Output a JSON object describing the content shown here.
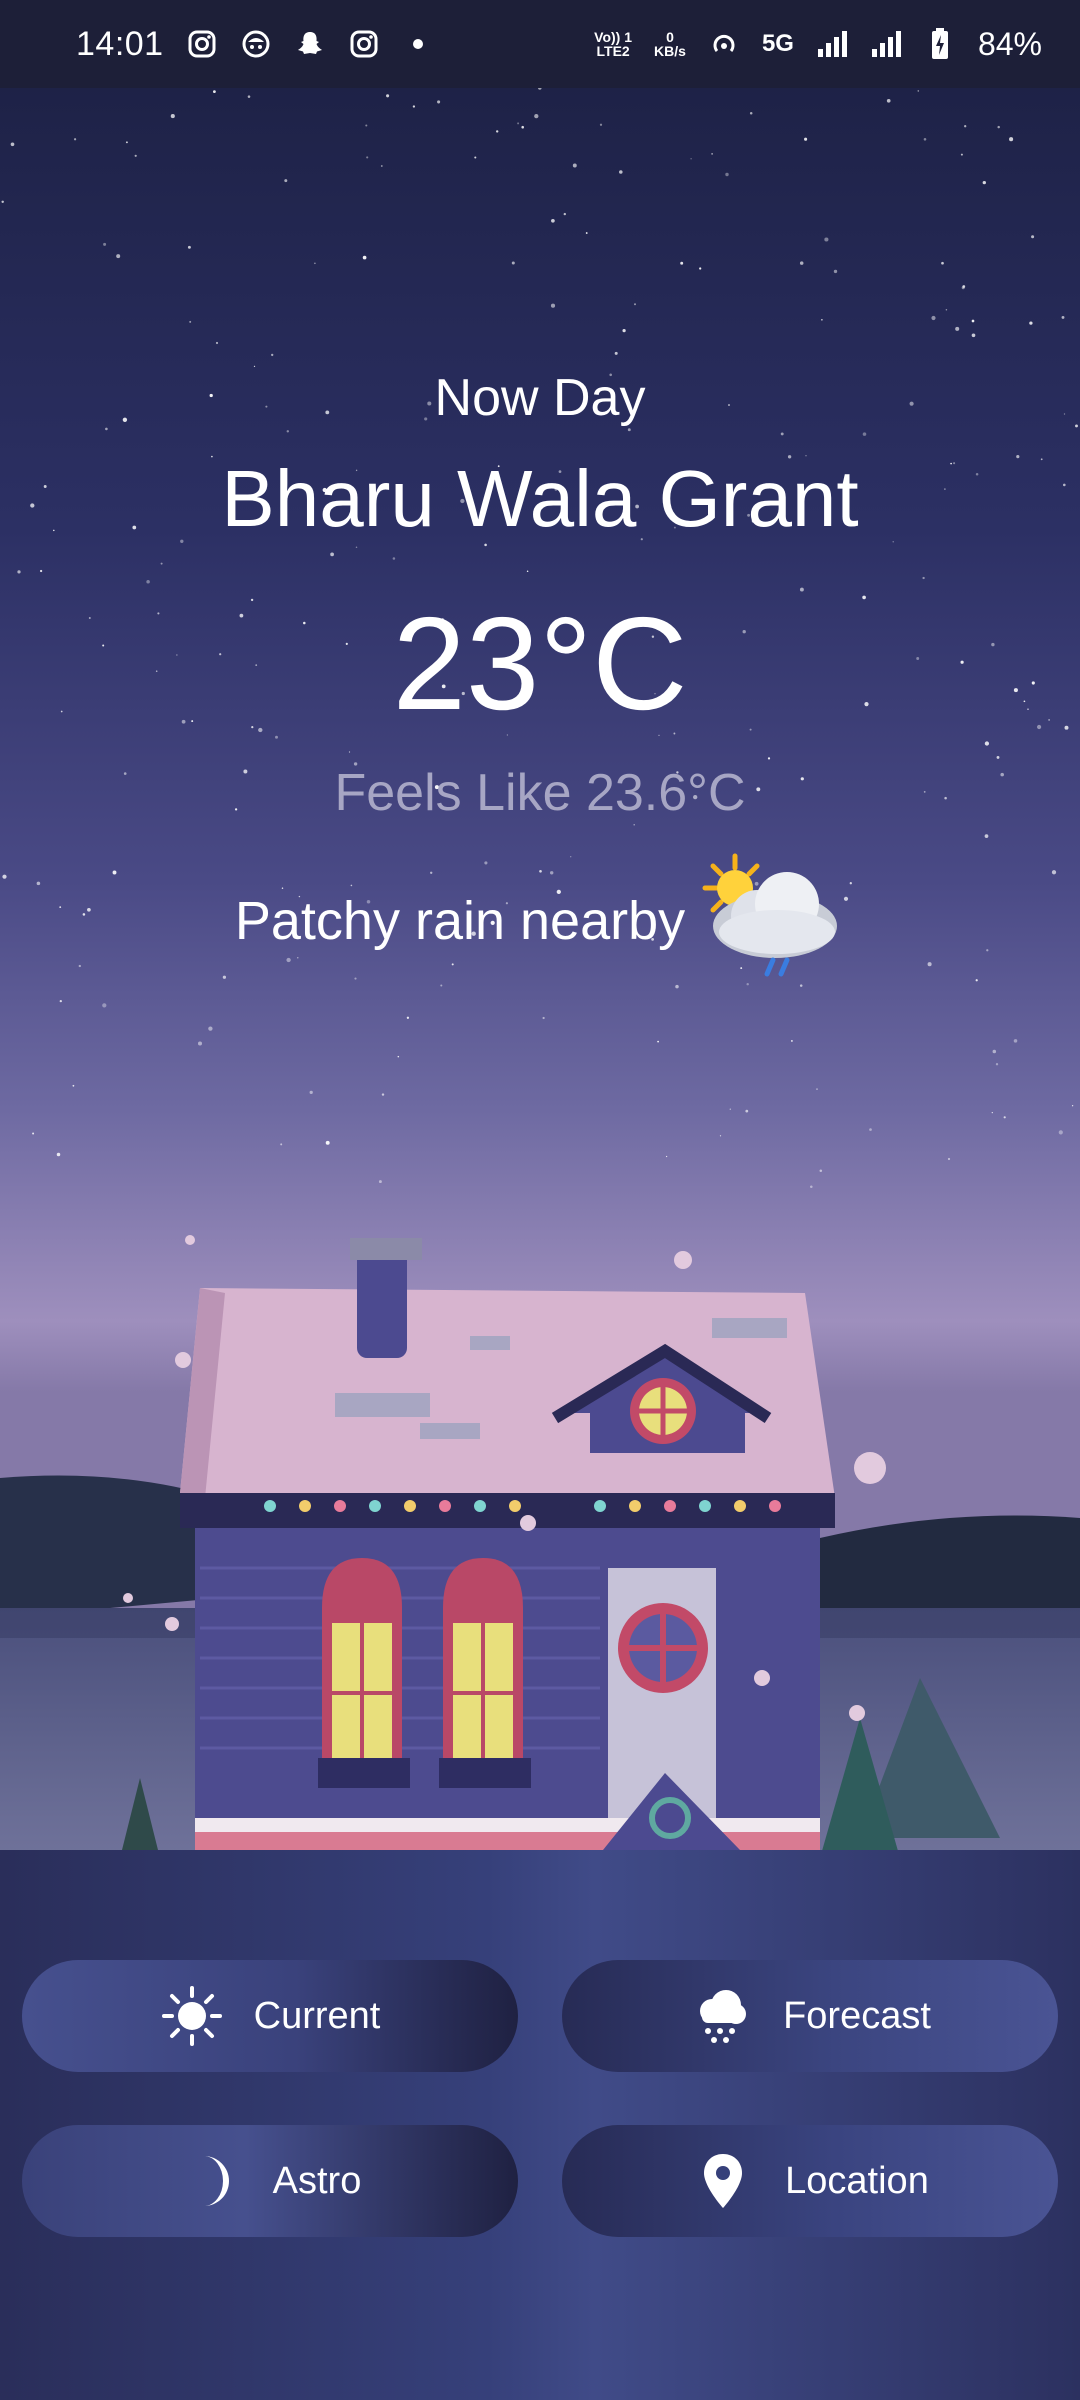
{
  "status_bar": {
    "time": "14:01",
    "notification_icons": [
      "instagram-icon",
      "app-icon",
      "snapchat-icon",
      "instagram-icon"
    ],
    "net_lte_line1": "Vo)) 1",
    "net_lte_line2": "LTE2",
    "net_speed_line1": "0",
    "net_speed_line2": "KB/s",
    "network_type": "5G",
    "battery": "84%"
  },
  "weather": {
    "period": "Now Day",
    "city": "Bharu Wala Grant",
    "temperature": "23°C",
    "feels_like": "Feels Like 23.6°C",
    "condition": "Patchy rain nearby",
    "condition_icon": "sun-cloud-rain-icon"
  },
  "nav": {
    "current": "Current",
    "forecast": "Forecast",
    "astro": "Astro",
    "location": "Location"
  },
  "colors": {
    "panel": "#36407a",
    "sky_top": "#1e2247",
    "house_roof": "#d7b4cf",
    "house_wall": "#4d4b8f"
  }
}
